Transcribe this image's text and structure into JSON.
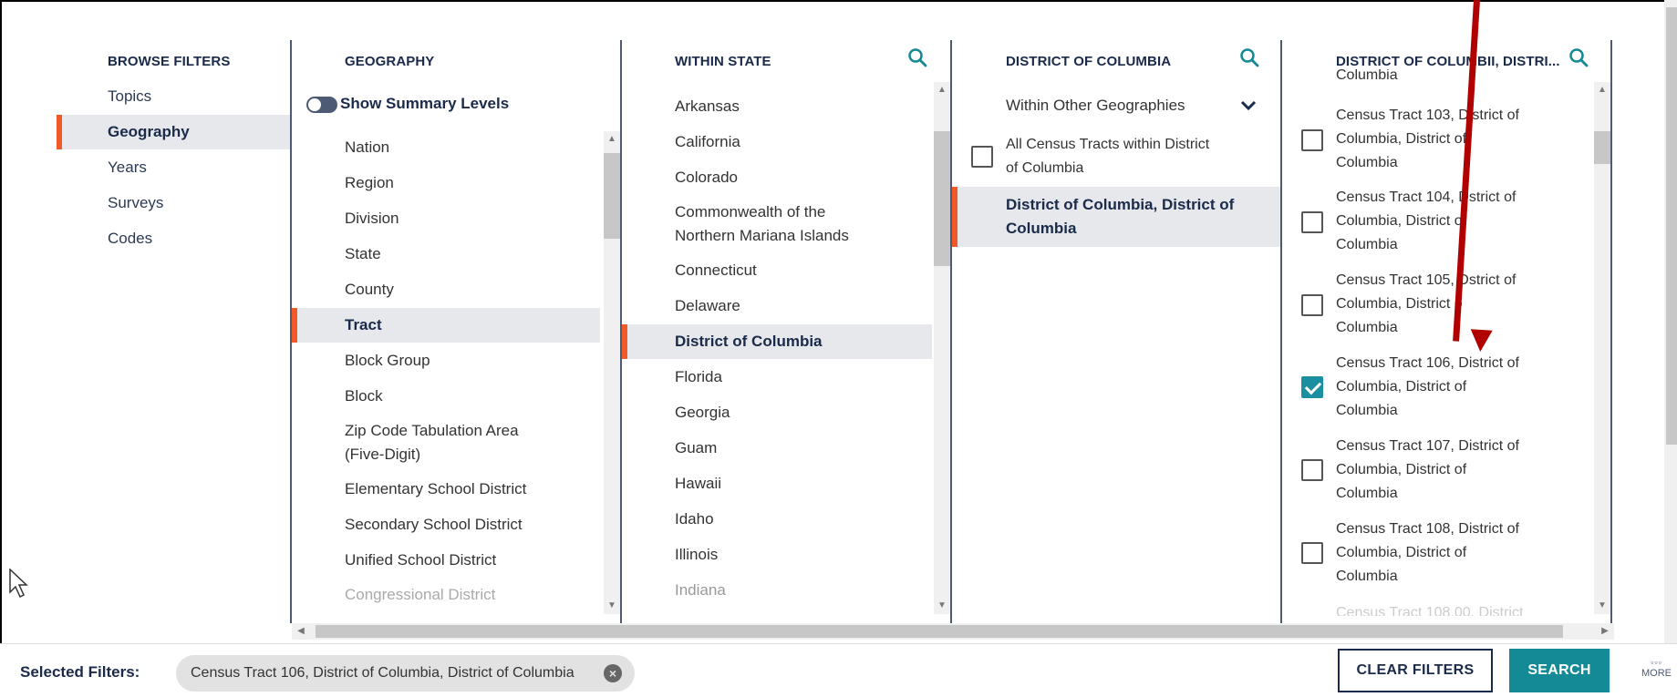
{
  "browse_filters": {
    "header": "BROWSE FILTERS",
    "items": [
      "Topics",
      "Geography",
      "Years",
      "Surveys",
      "Codes"
    ],
    "active": "Geography"
  },
  "geography": {
    "header": "GEOGRAPHY",
    "toggle_label": "Show Summary Levels",
    "items": [
      "Nation",
      "Region",
      "Division",
      "State",
      "County",
      "Tract",
      "Block Group",
      "Block",
      "Zip Code Tabulation Area",
      "(Five-Digit)",
      "Elementary School District",
      "Secondary School District",
      "Unified School District",
      "Congressional District"
    ],
    "active": "Tract"
  },
  "within_state": {
    "header": "WITHIN STATE",
    "items": [
      "Arkansas",
      "California",
      "Colorado",
      "Commonwealth of the",
      "Northern Mariana Islands",
      "Connecticut",
      "Delaware",
      "District of Columbia",
      "Florida",
      "Georgia",
      "Guam",
      "Hawaii",
      "Idaho",
      "Illinois",
      "Indiana"
    ],
    "active": "District of Columbia"
  },
  "district_col": {
    "header": "DISTRICT OF COLUMBIA",
    "dropdown_label": "Within Other Geographies",
    "all_tracts_line1": "All Census Tracts within District",
    "all_tracts_line2": "of Columbia",
    "active_line1": "District of Columbia, District of",
    "active_line2": "Columbia"
  },
  "tract_col": {
    "header": "DISTRICT OF COLUMBI",
    "header_suffix": "I, DISTRI...",
    "partial_top": "Columbia",
    "tracts": [
      {
        "line1": "Census Tract 103, Di",
        "line1b": "strict of",
        "line2": "Columbia, District of",
        "line3": "Columbia",
        "checked": false
      },
      {
        "line1": "Census Tract 104, D",
        "line1b": "strict of",
        "line2": "Columbia, District o",
        "line3": "Columbia",
        "checked": false
      },
      {
        "line1": "Census Tract 105, D",
        "line1b": "strict of",
        "line2": "Columbia, District o",
        "line3": "Columbia",
        "checked": false
      },
      {
        "line1": "Census Tract 106, D",
        "line1b": "istrict of",
        "line2": "Columbia, District of",
        "line3": "Columbia",
        "checked": true
      },
      {
        "line1": "Census Tract 107, District of",
        "line1b": "",
        "line2": "Columbia, District of",
        "line3": "Columbia",
        "checked": false
      },
      {
        "line1": "Census Tract 108, District of",
        "line1b": "",
        "line2": "Columbia, District of",
        "line3": "Columbia",
        "checked": false
      }
    ],
    "partial_bottom": "Census Tract 108.00, District"
  },
  "bottom": {
    "selected_label": "Selected Filters:",
    "chip_text": "Census Tract 106, District of Columbia, District of Columbia",
    "clear_label": "CLEAR FILTERS",
    "search_label": "SEARCH",
    "more_label": "MORE"
  },
  "colors": {
    "accent_orange": "#f05a28",
    "teal": "#148a96",
    "navy": "#1a2a4a",
    "annotation_arrow": "#b00000"
  }
}
